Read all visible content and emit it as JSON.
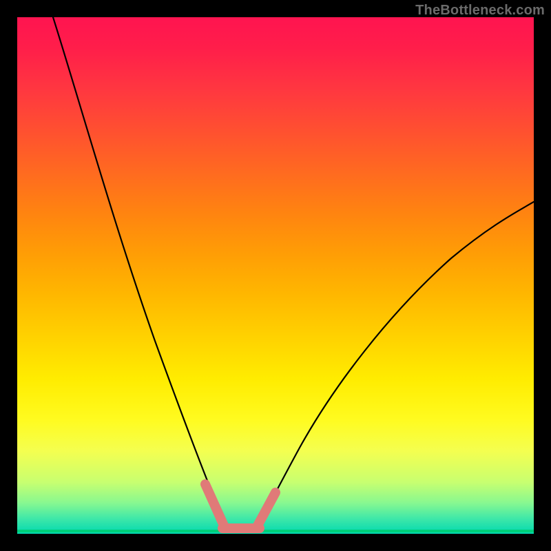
{
  "watermark": "TheBottleneck.com",
  "colors": {
    "background": "#000000",
    "curve": "#000000",
    "highlight": "#e07a78",
    "floor": "#00cf7a",
    "gradient_top": "#ff1450",
    "gradient_mid": "#ffec00",
    "gradient_bottom": "#00d8b0"
  },
  "chart_data": {
    "type": "line",
    "title": "",
    "xlabel": "",
    "ylabel": "",
    "xlim": [
      0,
      100
    ],
    "ylim": [
      0,
      100
    ],
    "series": [
      {
        "name": "left-curve",
        "x": [
          7,
          10,
          14,
          18,
          22,
          26,
          30,
          33,
          36,
          38,
          40
        ],
        "y": [
          100,
          90,
          77,
          64,
          51,
          38,
          26,
          16,
          8,
          4,
          1
        ]
      },
      {
        "name": "right-curve",
        "x": [
          46,
          49,
          53,
          58,
          64,
          71,
          79,
          88,
          98
        ],
        "y": [
          1,
          5,
          12,
          21,
          31,
          41,
          50,
          58,
          64
        ]
      },
      {
        "name": "valley-floor",
        "x": [
          40,
          46
        ],
        "y": [
          1,
          1
        ]
      }
    ],
    "annotations": [
      {
        "name": "highlight-segment",
        "x": [
          36,
          38,
          40,
          43,
          46,
          48,
          50
        ],
        "y": [
          9,
          4,
          1,
          1,
          1,
          3,
          7
        ],
        "stroke": "#e07a78"
      }
    ]
  }
}
